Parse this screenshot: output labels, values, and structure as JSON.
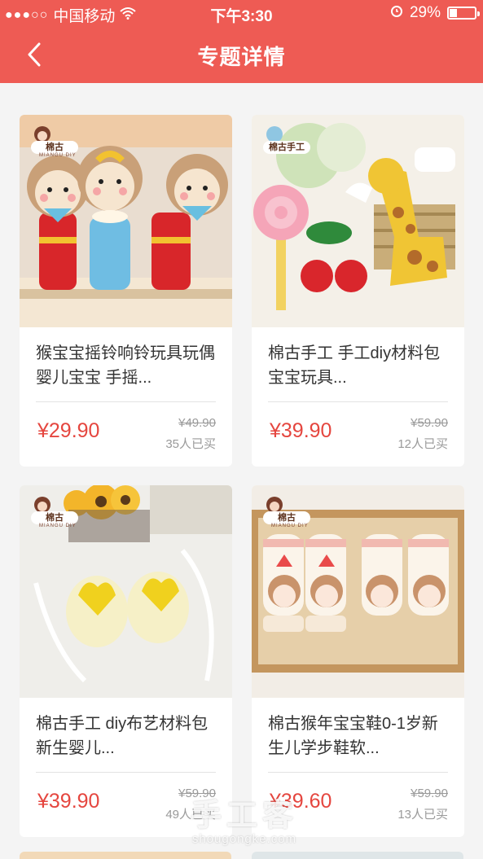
{
  "status_bar": {
    "signal_dots": "●●●○○",
    "carrier": "中国移动",
    "time": "下午3:30",
    "battery_percent": "29%",
    "battery_level": 0.29
  },
  "nav": {
    "title": "专题详情"
  },
  "logo": {
    "text": "棉古",
    "sub": "MIANGU DIY",
    "text_alt": "棉古手工"
  },
  "products": [
    {
      "name": "猴宝宝摇铃响铃玩具玩偶婴儿宝宝 手摇...",
      "price": "¥29.90",
      "original_price": "¥49.90",
      "sold": "35人已买"
    },
    {
      "name": "棉古手工 手工diy材料包宝宝玩具...",
      "price": "¥39.90",
      "original_price": "¥59.90",
      "sold": "12人已买"
    },
    {
      "name": "棉古手工 diy布艺材料包新生婴儿...",
      "price": "¥39.90",
      "original_price": "¥59.90",
      "sold": "49人已买"
    },
    {
      "name": "棉古猴年宝宝鞋0-1岁新生儿学步鞋软...",
      "price": "¥39.60",
      "original_price": "¥59.90",
      "sold": "13人已买"
    }
  ],
  "watermark": {
    "text": "手工客",
    "url": "shougongke.com"
  }
}
